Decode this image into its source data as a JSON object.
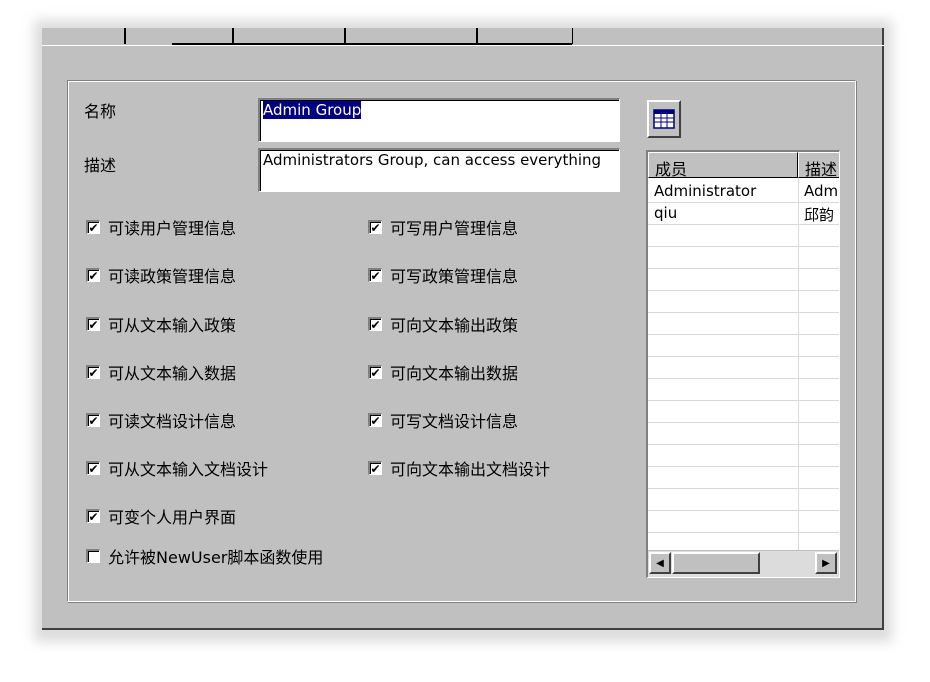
{
  "form": {
    "name_label": "名称",
    "name_value": "Admin Group",
    "desc_label": "描述",
    "desc_value": "Administrators Group, can access everything"
  },
  "permissions_left": [
    {
      "label": "可读用户管理信息",
      "checked": true
    },
    {
      "label": "可读政策管理信息",
      "checked": true
    },
    {
      "label": "可从文本输入政策",
      "checked": true
    },
    {
      "label": "可从文本输入数据",
      "checked": true
    },
    {
      "label": "可读文档设计信息",
      "checked": true
    },
    {
      "label": "可从文本输入文档设计",
      "checked": true
    },
    {
      "label": "可变个人用户界面",
      "checked": true
    },
    {
      "label": "允许被NewUser脚本函数使用",
      "checked": false
    }
  ],
  "permissions_right": [
    {
      "label": "可写用户管理信息",
      "checked": true
    },
    {
      "label": "可写政策管理信息",
      "checked": true
    },
    {
      "label": "可向文本输出政策",
      "checked": true
    },
    {
      "label": "可向文本输出数据",
      "checked": true
    },
    {
      "label": "可写文档设计信息",
      "checked": true
    },
    {
      "label": "可向文本输出文档设计",
      "checked": true
    }
  ],
  "members": {
    "columns": [
      "成员",
      "描述"
    ],
    "rows": [
      {
        "member": "Administrator",
        "description": "Adm"
      },
      {
        "member": "qiu",
        "description": "邱韵"
      }
    ]
  },
  "icons": {
    "toolbar": "table-icon",
    "scroll_left": "arrow-left-icon",
    "scroll_right": "arrow-right-icon"
  },
  "colors": {
    "dialog_bg": "#c0c0c0",
    "selection": "#000080"
  }
}
